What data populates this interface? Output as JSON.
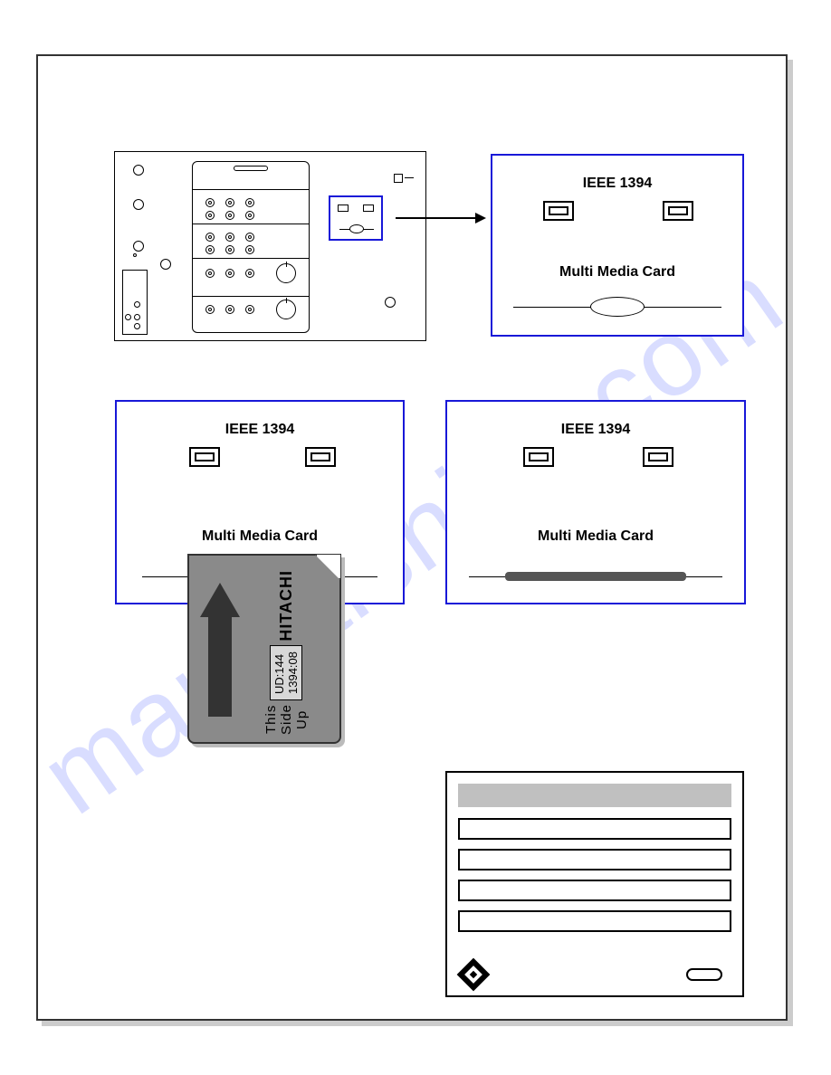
{
  "watermark": "manualshive.com",
  "detail_panels": {
    "title_ieee": "IEEE 1394",
    "mmc_label": "Multi Media Card"
  },
  "mmc_card": {
    "brand": "HITACHI",
    "ud_label": "UD:144 1394:08",
    "side_label": "This Side Up"
  }
}
